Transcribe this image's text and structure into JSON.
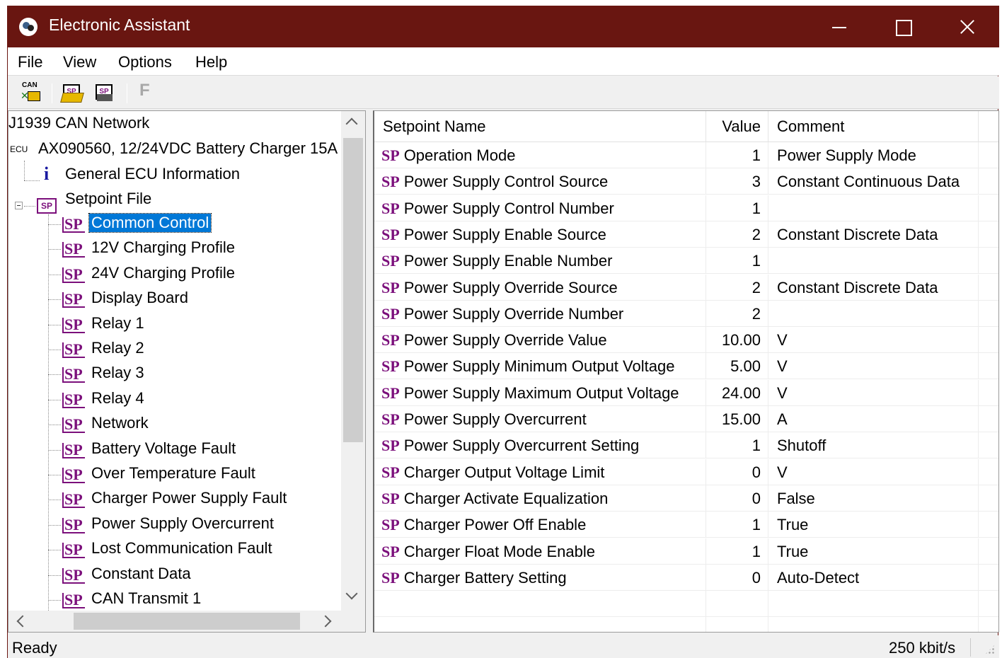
{
  "window": {
    "title": "Electronic Assistant"
  },
  "menu": [
    "File",
    "View",
    "Options",
    "Help"
  ],
  "toolbar": {
    "can_label": "CAN",
    "open_label": "SP",
    "save_label": "SP",
    "f_label": "F"
  },
  "tree": {
    "network": "J1939 CAN Network",
    "ecu_badge": "ECU",
    "ecu": "AX090560, 12/24VDC Battery Charger 15A",
    "info": "General ECU Information",
    "setpoint_file": "Setpoint File",
    "setpoint_file_badge": "SP",
    "sp_icon": "SP",
    "items": [
      "Common Control",
      "12V Charging Profile",
      "24V Charging Profile",
      "Display Board",
      "Relay 1",
      "Relay 2",
      "Relay 3",
      "Relay 4",
      "Network",
      "Battery Voltage Fault",
      "Over Temperature Fault",
      "Charger Power Supply Fault",
      "Power Supply Overcurrent",
      "Lost Communication Fault",
      "Constant Data",
      "CAN Transmit 1"
    ],
    "selected": "Common Control"
  },
  "grid": {
    "headers": {
      "name": "Setpoint Name",
      "value": "Value",
      "comment": "Comment"
    },
    "sp_mark": "SP",
    "rows": [
      {
        "name": "Operation Mode",
        "value": "1",
        "comment": "Power Supply Mode"
      },
      {
        "name": "Power Supply Control Source",
        "value": "3",
        "comment": "Constant Continuous Data"
      },
      {
        "name": "Power Supply Control Number",
        "value": "1",
        "comment": ""
      },
      {
        "name": "Power Supply Enable Source",
        "value": "2",
        "comment": "Constant Discrete Data"
      },
      {
        "name": "Power Supply Enable Number",
        "value": "1",
        "comment": ""
      },
      {
        "name": "Power Supply Override Source",
        "value": "2",
        "comment": "Constant Discrete Data"
      },
      {
        "name": "Power Supply Override Number",
        "value": "2",
        "comment": ""
      },
      {
        "name": "Power Supply Override Value",
        "value": "10.00",
        "comment": "V"
      },
      {
        "name": "Power Supply Minimum Output Voltage",
        "value": "5.00",
        "comment": "V"
      },
      {
        "name": "Power Supply Maximum Output Voltage",
        "value": "24.00",
        "comment": "V"
      },
      {
        "name": "Power Supply Overcurrent",
        "value": "15.00",
        "comment": "A"
      },
      {
        "name": "Power Supply Overcurrent Setting",
        "value": "1",
        "comment": "Shutoff"
      },
      {
        "name": "Charger Output Voltage Limit",
        "value": "0",
        "comment": "V"
      },
      {
        "name": "Charger Activate Equalization",
        "value": "0",
        "comment": "False"
      },
      {
        "name": "Charger Power Off Enable",
        "value": "1",
        "comment": "True"
      },
      {
        "name": "Charger Float Mode Enable",
        "value": "1",
        "comment": "True"
      },
      {
        "name": "Charger Battery Setting",
        "value": "0",
        "comment": "Auto-Detect"
      }
    ]
  },
  "status": {
    "text": "Ready",
    "rate": "250 kbit/s"
  },
  "colors": {
    "titlebar": "#691611",
    "selection": "#0078d7",
    "sp_icon": "#7b0f7b"
  }
}
